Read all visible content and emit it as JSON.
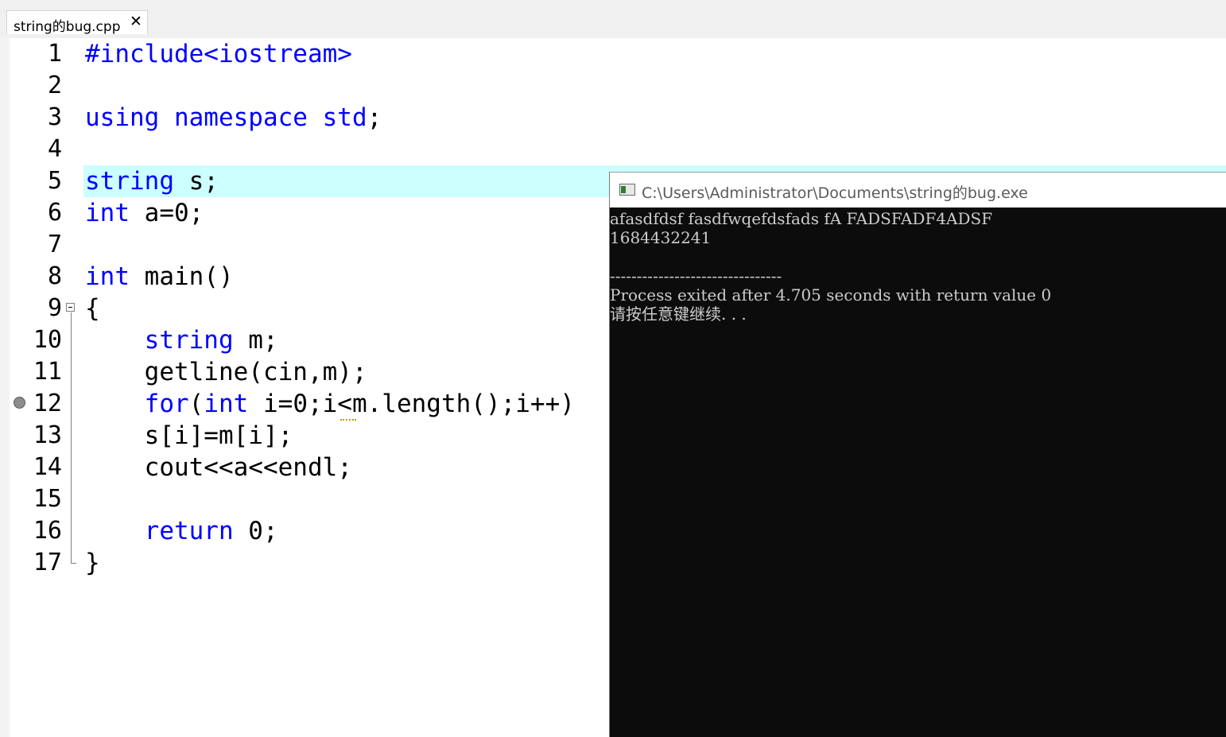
{
  "tab": {
    "label": "string的bug.cpp",
    "close": "✕"
  },
  "editor": {
    "lines": [
      {
        "num": "1"
      },
      {
        "num": "2"
      },
      {
        "num": "3"
      },
      {
        "num": "4"
      },
      {
        "num": "5"
      },
      {
        "num": "6"
      },
      {
        "num": "7"
      },
      {
        "num": "8"
      },
      {
        "num": "9"
      },
      {
        "num": "10"
      },
      {
        "num": "11"
      },
      {
        "num": "12"
      },
      {
        "num": "13"
      },
      {
        "num": "14"
      },
      {
        "num": "15"
      },
      {
        "num": "16"
      },
      {
        "num": "17"
      }
    ],
    "code": {
      "l1": "#include<iostream>",
      "l3_kw": "using namespace std",
      "l3_rest": ";",
      "l5_kw": "string",
      "l5_rest": " s;",
      "l6_kw": "int",
      "l6_rest": " a=0;",
      "l8_kw": "int",
      "l8_rest": " main()",
      "l9": "{",
      "l10_indent": "    ",
      "l10_kw": "string",
      "l10_rest": " m;",
      "l11": "    getline(cin,m);",
      "l12_indent": "    ",
      "l12_kw1": "for",
      "l12_mid": "(",
      "l12_kw2": "int",
      "l12_rest": " i=0;i<m.length();i++)",
      "l13": "    s[i]=m[i];",
      "l14": "    cout<<a<<endl;",
      "l16_indent": "    ",
      "l16_kw": "return",
      "l16_rest": " 0;",
      "l17": "}"
    },
    "colors": {
      "keyword": "#0000ff",
      "highlight": "#ccffff"
    }
  },
  "console": {
    "title": "C:\\Users\\Administrator\\Documents\\string的bug.exe",
    "output": [
      "afasdfdsf fasdfwqefdsfads fA FADSFADF4ADSF",
      "1684432241",
      "",
      "--------------------------------",
      "Process exited after 4.705 seconds with return value 0",
      "请按任意键继续. . ."
    ]
  }
}
